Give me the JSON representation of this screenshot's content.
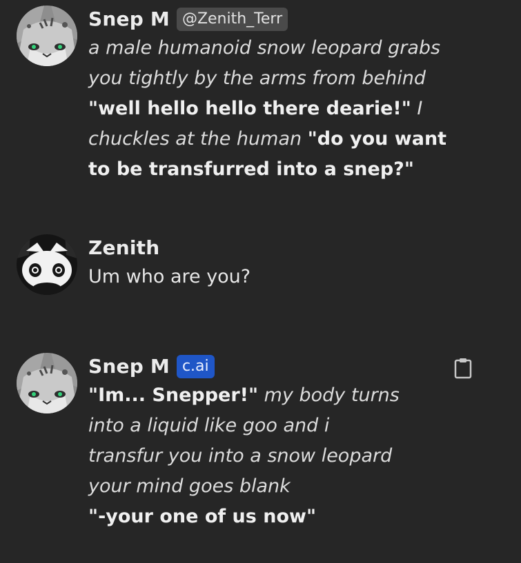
{
  "messages": [
    {
      "name": "Snep M",
      "tag": "@Zenith_Terr",
      "lines": [
        [
          {
            "style": "it",
            "text": "a male humanoid snow leopard grabs"
          }
        ],
        [
          {
            "style": "it",
            "text": "you tightly by the arms from behind"
          }
        ],
        [
          {
            "style": "b",
            "text": "\"well hello hello there dearie!\""
          },
          {
            "style": "it",
            "text": " I"
          }
        ],
        [
          {
            "style": "it",
            "text": "chuckles at the human "
          },
          {
            "style": "b",
            "text": "\"do you want"
          }
        ],
        [
          {
            "style": "b",
            "text": "to be transfurred into a snep?\""
          }
        ]
      ]
    },
    {
      "name": "Zenith",
      "lines": [
        [
          {
            "style": "plain",
            "text": "Um who are you?"
          }
        ]
      ]
    },
    {
      "name": "Snep M",
      "tag": "c.ai",
      "lines": [
        [
          {
            "style": "b",
            "text": "\"Im... Snepper!\""
          },
          {
            "style": "it",
            "text": " my body turns"
          }
        ],
        [
          {
            "style": "it",
            "text": "into a liquid like goo and i"
          }
        ],
        [
          {
            "style": "it",
            "text": "transfur you into a snow leopard"
          }
        ],
        [
          {
            "style": "it",
            "text": "your mind goes blank"
          }
        ],
        [
          {
            "style": "b",
            "text": "\"-your one of us now\""
          }
        ]
      ]
    }
  ],
  "icons": {
    "copy": "clipboard-icon",
    "avatar_bot": "snow-leopard-avatar-icon",
    "avatar_user": "black-white-creature-avatar-icon"
  },
  "colors": {
    "background": "#262626",
    "handle_badge": "#4a4a4a",
    "cai_badge": "#1f56c7"
  }
}
